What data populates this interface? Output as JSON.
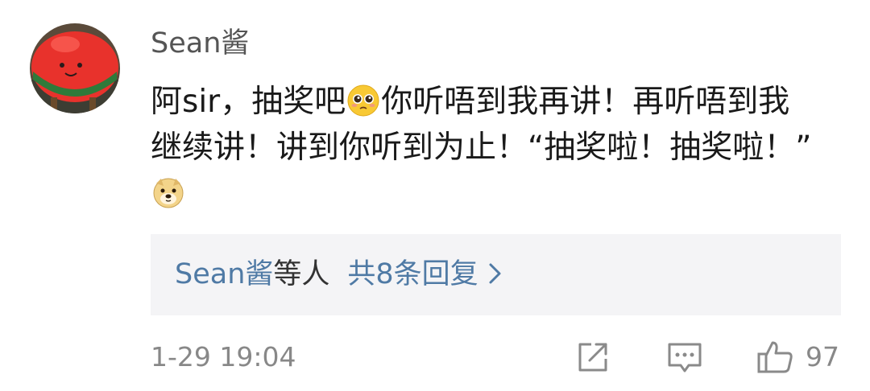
{
  "comment": {
    "username": "Sean酱",
    "text_parts": [
      "阿sir，抽奖吧",
      "你听唔到我再讲！再听唔到我继续讲！讲到你听到为止！“抽奖啦！抽奖啦！”"
    ],
    "emoji_1": "pleading-face-emoji",
    "emoji_2": "doge-emoji",
    "timestamp": "1-29 19:04",
    "like_count": "97"
  },
  "replies": {
    "name": "Sean酱",
    "suffix": "等人",
    "count_label": "共8条回复"
  },
  "icons": {
    "share": "share-icon",
    "comment": "comment-icon",
    "like": "thumbs-up-icon",
    "reply_arrow": "chevron-right-icon"
  },
  "colors": {
    "link_blue": "#4f7aa5",
    "muted_gray": "#888888",
    "reply_bg": "#f4f4f6",
    "avatar_red": "#e8322c"
  }
}
